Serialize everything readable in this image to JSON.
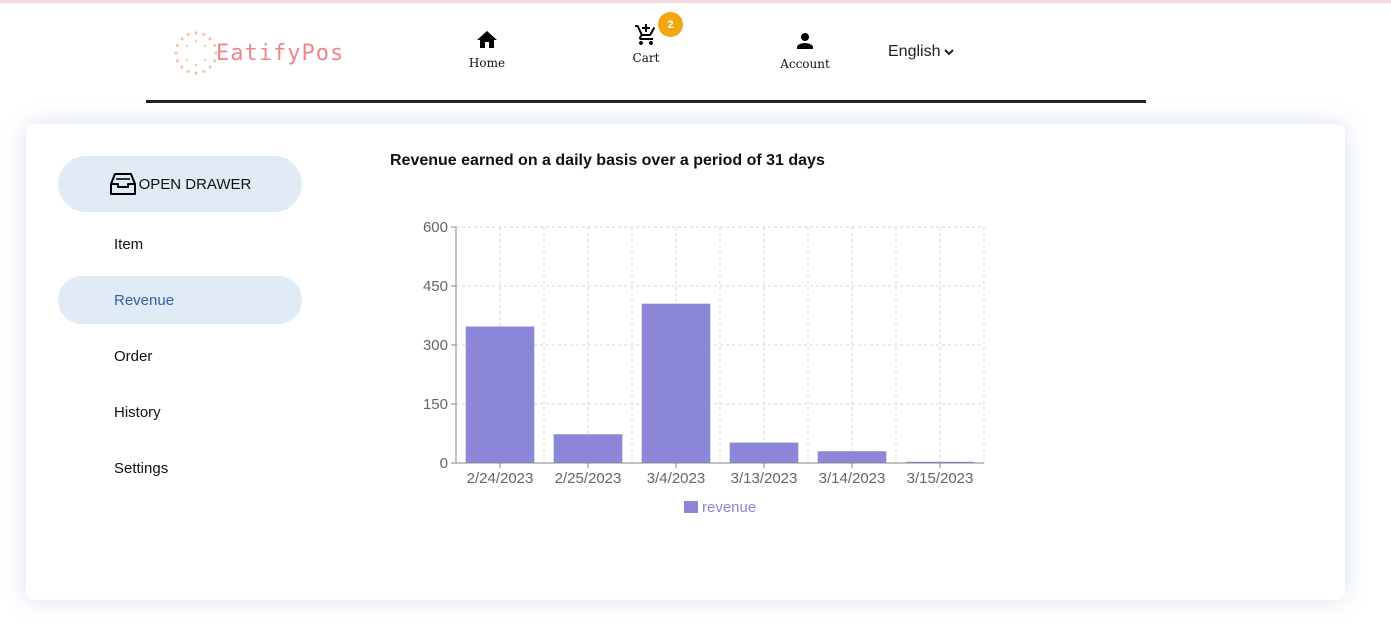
{
  "header": {
    "logo_text": "EatifyPos",
    "nav": [
      {
        "label": "Home",
        "icon": "home-icon"
      },
      {
        "label": "Cart",
        "icon": "cart-icon",
        "badge": "2"
      },
      {
        "label": "Account",
        "icon": "account-icon"
      }
    ],
    "language": "English"
  },
  "sidebar": {
    "drawer_label": "OPEN DRAWER",
    "items": [
      {
        "label": "Item",
        "active": false
      },
      {
        "label": "Revenue",
        "active": true
      },
      {
        "label": "Order",
        "active": false
      },
      {
        "label": "History",
        "active": false
      },
      {
        "label": "Settings",
        "active": false
      }
    ]
  },
  "chart": {
    "title": "Revenue earned on a daily basis over a period of 31 days"
  },
  "colors": {
    "brand": "#f0848c",
    "bar": "#8b86d8",
    "active_bg": "#e0ebf5",
    "active_text": "#2f5fae",
    "badge": "#f3a514"
  },
  "chart_data": {
    "type": "bar",
    "title": "Revenue earned on a daily basis over a period of 31 days",
    "categories": [
      "2/24/2023",
      "2/25/2023",
      "3/4/2023",
      "3/13/2023",
      "3/14/2023",
      "3/15/2023"
    ],
    "series": [
      {
        "name": "revenue",
        "values": [
          347,
          73,
          405,
          52,
          30,
          3
        ]
      }
    ],
    "yticks": [
      0,
      150,
      300,
      450,
      600
    ],
    "ylim": [
      0,
      600
    ],
    "grid": true,
    "legend": "bottom-center"
  }
}
